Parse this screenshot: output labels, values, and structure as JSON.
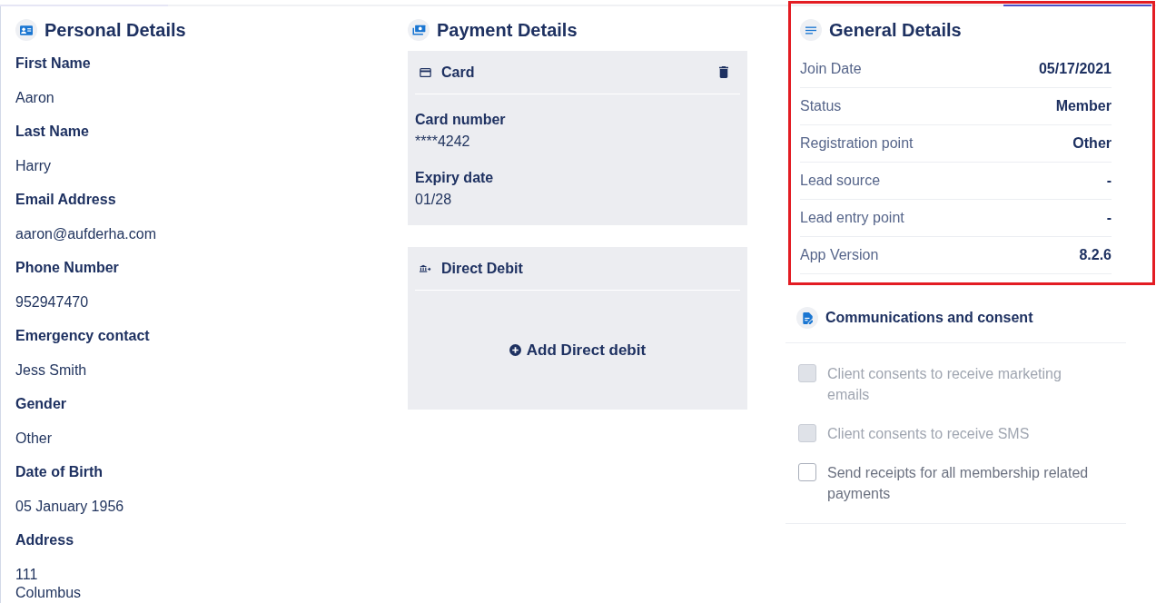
{
  "personal_details": {
    "title": "Personal Details",
    "fields": [
      {
        "label": "First Name",
        "value": "Aaron"
      },
      {
        "label": "Last Name",
        "value": "Harry"
      },
      {
        "label": "Email Address",
        "value": "aaron@aufderha.com"
      },
      {
        "label": "Phone Number",
        "value": "952947470"
      },
      {
        "label": "Emergency contact",
        "value": "Jess Smith"
      },
      {
        "label": "Gender",
        "value": "Other"
      },
      {
        "label": "Date of Birth",
        "value": "05 January 1956"
      },
      {
        "label": "Address",
        "lines": [
          "111",
          "Columbus"
        ]
      }
    ]
  },
  "payment_details": {
    "title": "Payment Details",
    "card": {
      "title": "Card",
      "fields": [
        {
          "label": "Card number",
          "value": "****4242"
        },
        {
          "label": "Expiry date",
          "value": "01/28"
        }
      ]
    },
    "direct_debit": {
      "title": "Direct Debit",
      "action": "Add Direct debit"
    }
  },
  "general_details": {
    "title": "General Details",
    "highlighted": true,
    "rows": [
      {
        "label": "Join Date",
        "value": "05/17/2021"
      },
      {
        "label": "Status",
        "value": "Member"
      },
      {
        "label": "Registration point",
        "value": "Other"
      },
      {
        "label": "Lead source",
        "value": "-"
      },
      {
        "label": "Lead entry point",
        "value": "-"
      },
      {
        "label": "App Version",
        "value": "8.2.6"
      }
    ]
  },
  "communications": {
    "title": "Communications and consent",
    "options": [
      {
        "label": "Client consents to receive marketing emails",
        "checked": false,
        "disabled": true
      },
      {
        "label": "Client consents to receive SMS",
        "checked": false,
        "disabled": true
      },
      {
        "label": "Send receipts for all membership related payments",
        "checked": false,
        "disabled": false
      }
    ]
  }
}
